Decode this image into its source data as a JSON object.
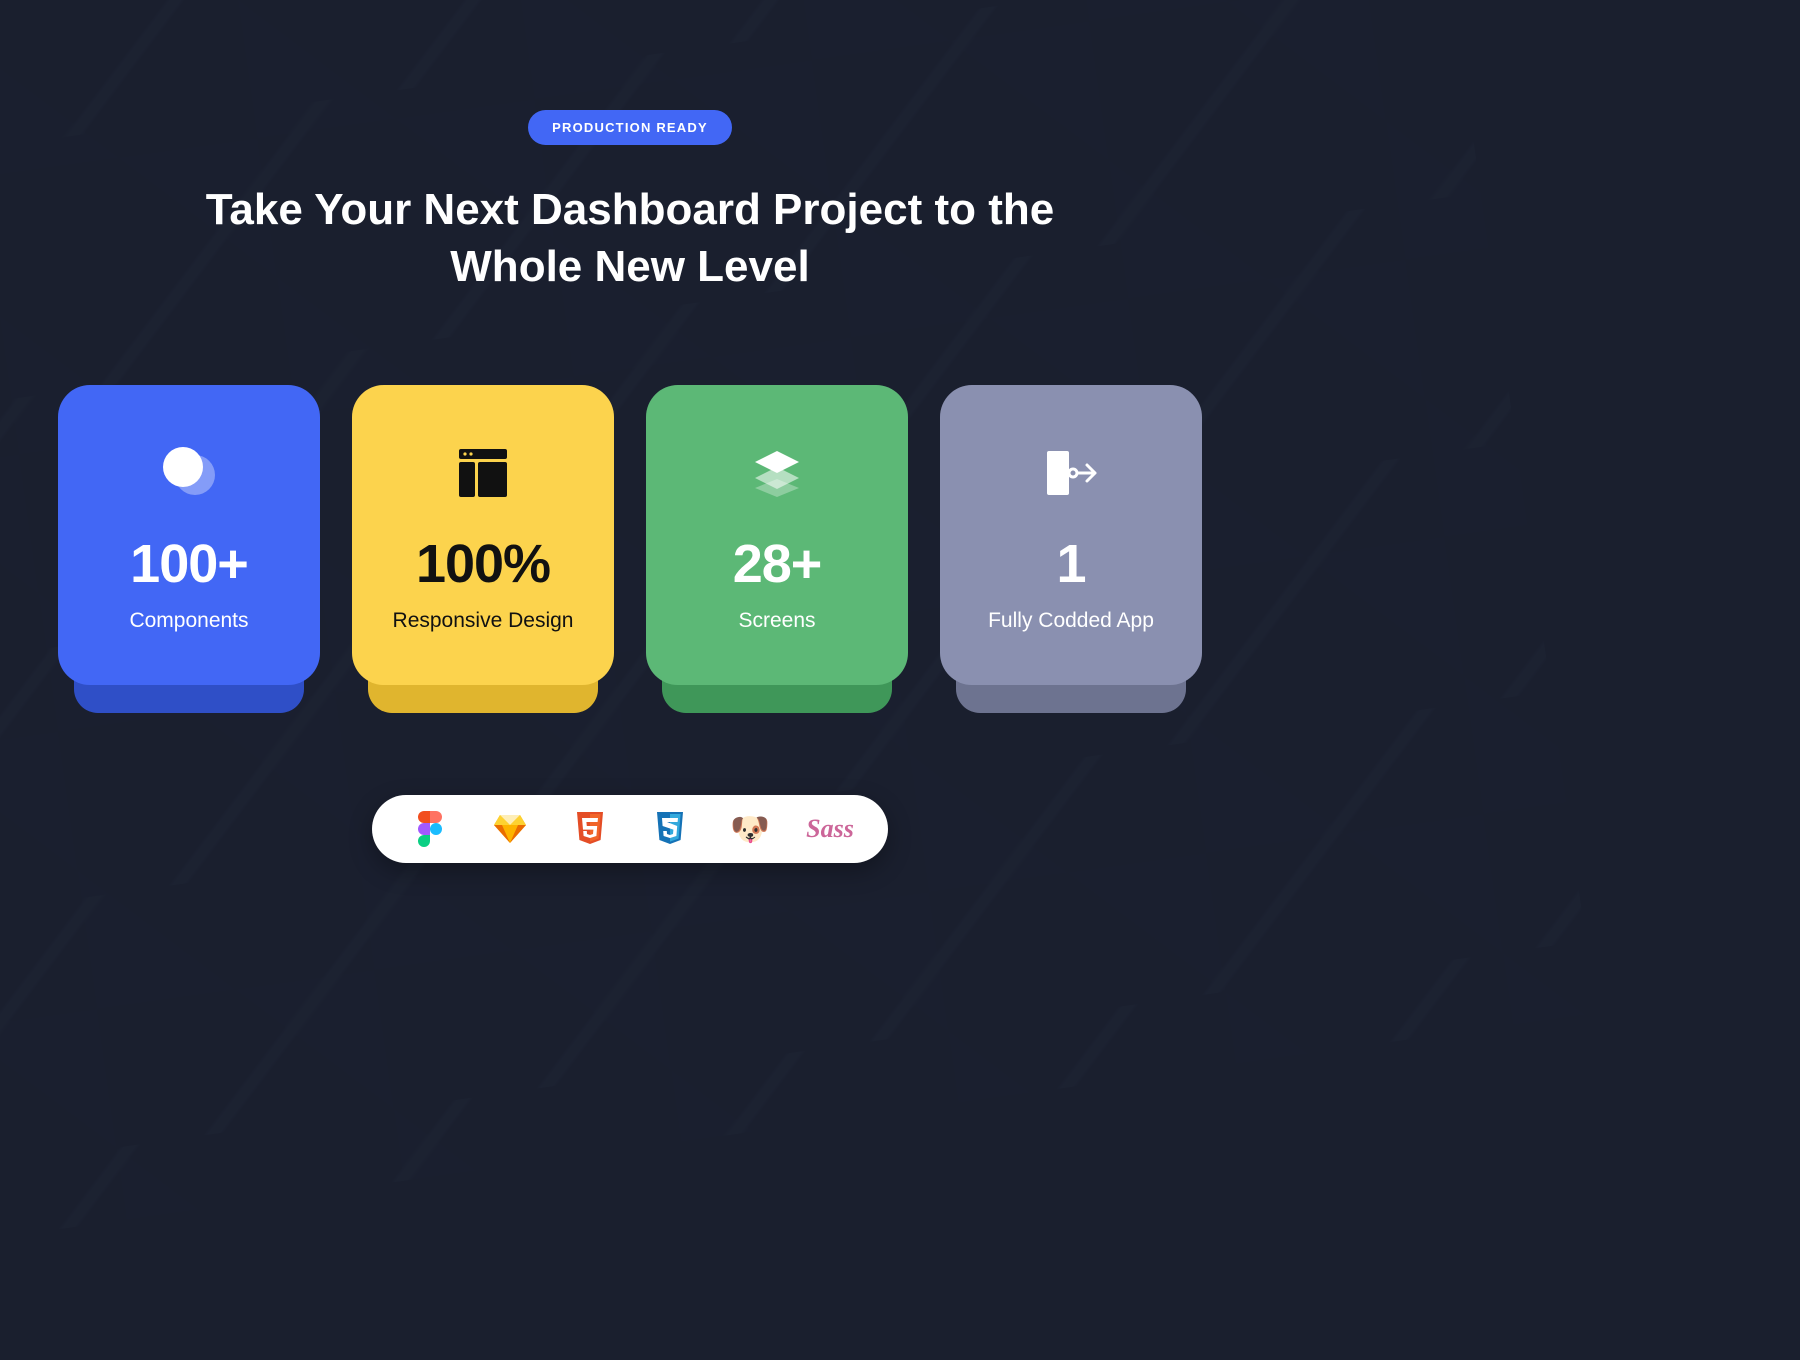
{
  "badge": "PRODUCTION READY",
  "headline": "Take Your Next Dashboard Project to the Whole New Level",
  "cards": [
    {
      "value": "100+",
      "label": "Components"
    },
    {
      "value": "100%",
      "label": "Responsive Design"
    },
    {
      "value": "28+",
      "label": "Screens"
    },
    {
      "value": "1",
      "label": "Fully Codded App"
    }
  ],
  "tech": {
    "figma": "Figma",
    "sketch": "Sketch",
    "html5": "HTML5",
    "css3": "CSS3",
    "pug": "Pug",
    "sass": "Sass"
  }
}
